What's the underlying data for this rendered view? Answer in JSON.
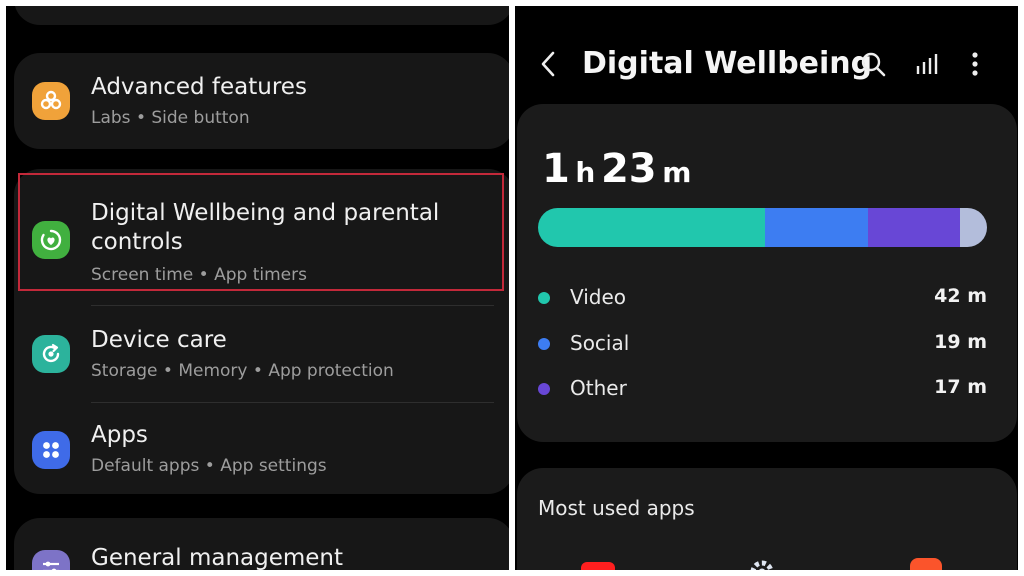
{
  "settings": {
    "items": [
      {
        "title": "Advanced features",
        "subtitle": "Labs  •  Side button",
        "icon": "advanced-features-icon",
        "color": "#f0a23a"
      },
      {
        "title": "Digital Wellbeing and parental controls",
        "subtitle": "Screen time  •  App timers",
        "icon": "digital-wellbeing-icon",
        "color": "#41b03f"
      },
      {
        "title": "Device care",
        "subtitle": "Storage  •  Memory  •  App protection",
        "icon": "device-care-icon",
        "color": "#2cb39c"
      },
      {
        "title": "Apps",
        "subtitle": "Default apps  •  App settings",
        "icon": "apps-icon",
        "color": "#3f6be8"
      },
      {
        "title": "General management",
        "icon": "general-management-icon",
        "color": "#7d73c7"
      }
    ],
    "highlight_color": "#c3293a"
  },
  "wellbeing": {
    "header": {
      "title": "Digital Wellbeing",
      "icons": [
        "back-icon",
        "search-icon",
        "bar-chart-icon",
        "more-options-icon"
      ]
    },
    "total": {
      "hours": "1",
      "h_unit": "h",
      "minutes": "23",
      "m_unit": "m"
    },
    "categories": [
      {
        "name": "Video",
        "value": "42 m",
        "minutes": 42,
        "color": "#21c7ad"
      },
      {
        "name": "Social",
        "value": "19 m",
        "minutes": 19,
        "color": "#3d7df2"
      },
      {
        "name": "Other",
        "value": "17 m",
        "minutes": 17,
        "color": "#6847d6"
      }
    ],
    "remaining_color": "#b3bddb",
    "most_used_label": "Most used apps",
    "most_used_icons": [
      {
        "name": "youtube-app-icon",
        "color": "#ffffff"
      },
      {
        "name": "settings-app-icon",
        "color": "#4b5c7a"
      },
      {
        "name": "brave-app-icon",
        "color": "#ffffff"
      }
    ]
  }
}
